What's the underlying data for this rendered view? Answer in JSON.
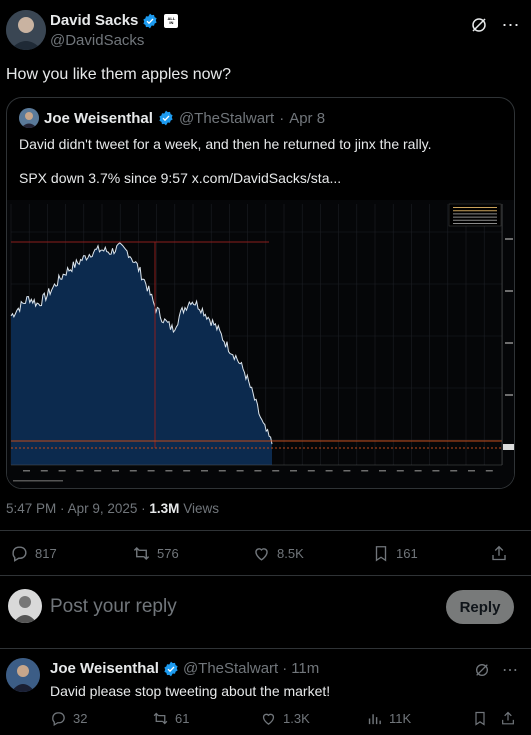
{
  "tweet": {
    "author": {
      "name": "David Sacks",
      "handle": "@DavidSacks",
      "badge_text": "ALL IN"
    },
    "text": "How you like them apples now?",
    "time": "5:47 PM",
    "date": "Apr 9, 2025",
    "separator": "·",
    "views_count": "1.3M",
    "views_label": "Views",
    "stats": {
      "replies": "817",
      "reposts": "576",
      "likes": "8.5K",
      "bookmarks": "161"
    }
  },
  "quote": {
    "author": {
      "name": "Joe Weisenthal",
      "handle": "@TheStalwart",
      "date": "Apr 8"
    },
    "line1": "David didn't tweet for a week, and then he returned to jinx the rally.",
    "line2": "SPX down 3.7% since 9:57  x.com/DavidSacks/sta..."
  },
  "compose": {
    "placeholder": "Post your reply",
    "button": "Reply"
  },
  "reply": {
    "author": {
      "name": "Joe Weisenthal",
      "handle": "@TheStalwart",
      "time": "11m"
    },
    "text": "David please stop tweeting about the market!",
    "stats": {
      "replies": "32",
      "reposts": "61",
      "likes": "1.3K",
      "views": "11K"
    }
  },
  "colors": {
    "accent": "#1d9bf0",
    "muted": "#71767b",
    "chart_fill": "#0c2a4e",
    "chart_line": "#dde6ee",
    "ref_line": "#8b1d1d"
  },
  "chart_data": {
    "type": "area",
    "title": "",
    "xlabel": "",
    "ylabel": "",
    "ylim": [
      0,
      1
    ],
    "note": "relative price path of SPX intraday, 0 = bottom of plot, 1 = top",
    "values": [
      0.58,
      0.62,
      0.66,
      0.63,
      0.67,
      0.72,
      0.77,
      0.8,
      0.83,
      0.86,
      0.87,
      0.86,
      0.88,
      0.86,
      0.8,
      0.72,
      0.62,
      0.56,
      0.52,
      0.6,
      0.65,
      0.62,
      0.57,
      0.52,
      0.45,
      0.4,
      0.33,
      0.22,
      0.1,
      0.02
    ]
  }
}
